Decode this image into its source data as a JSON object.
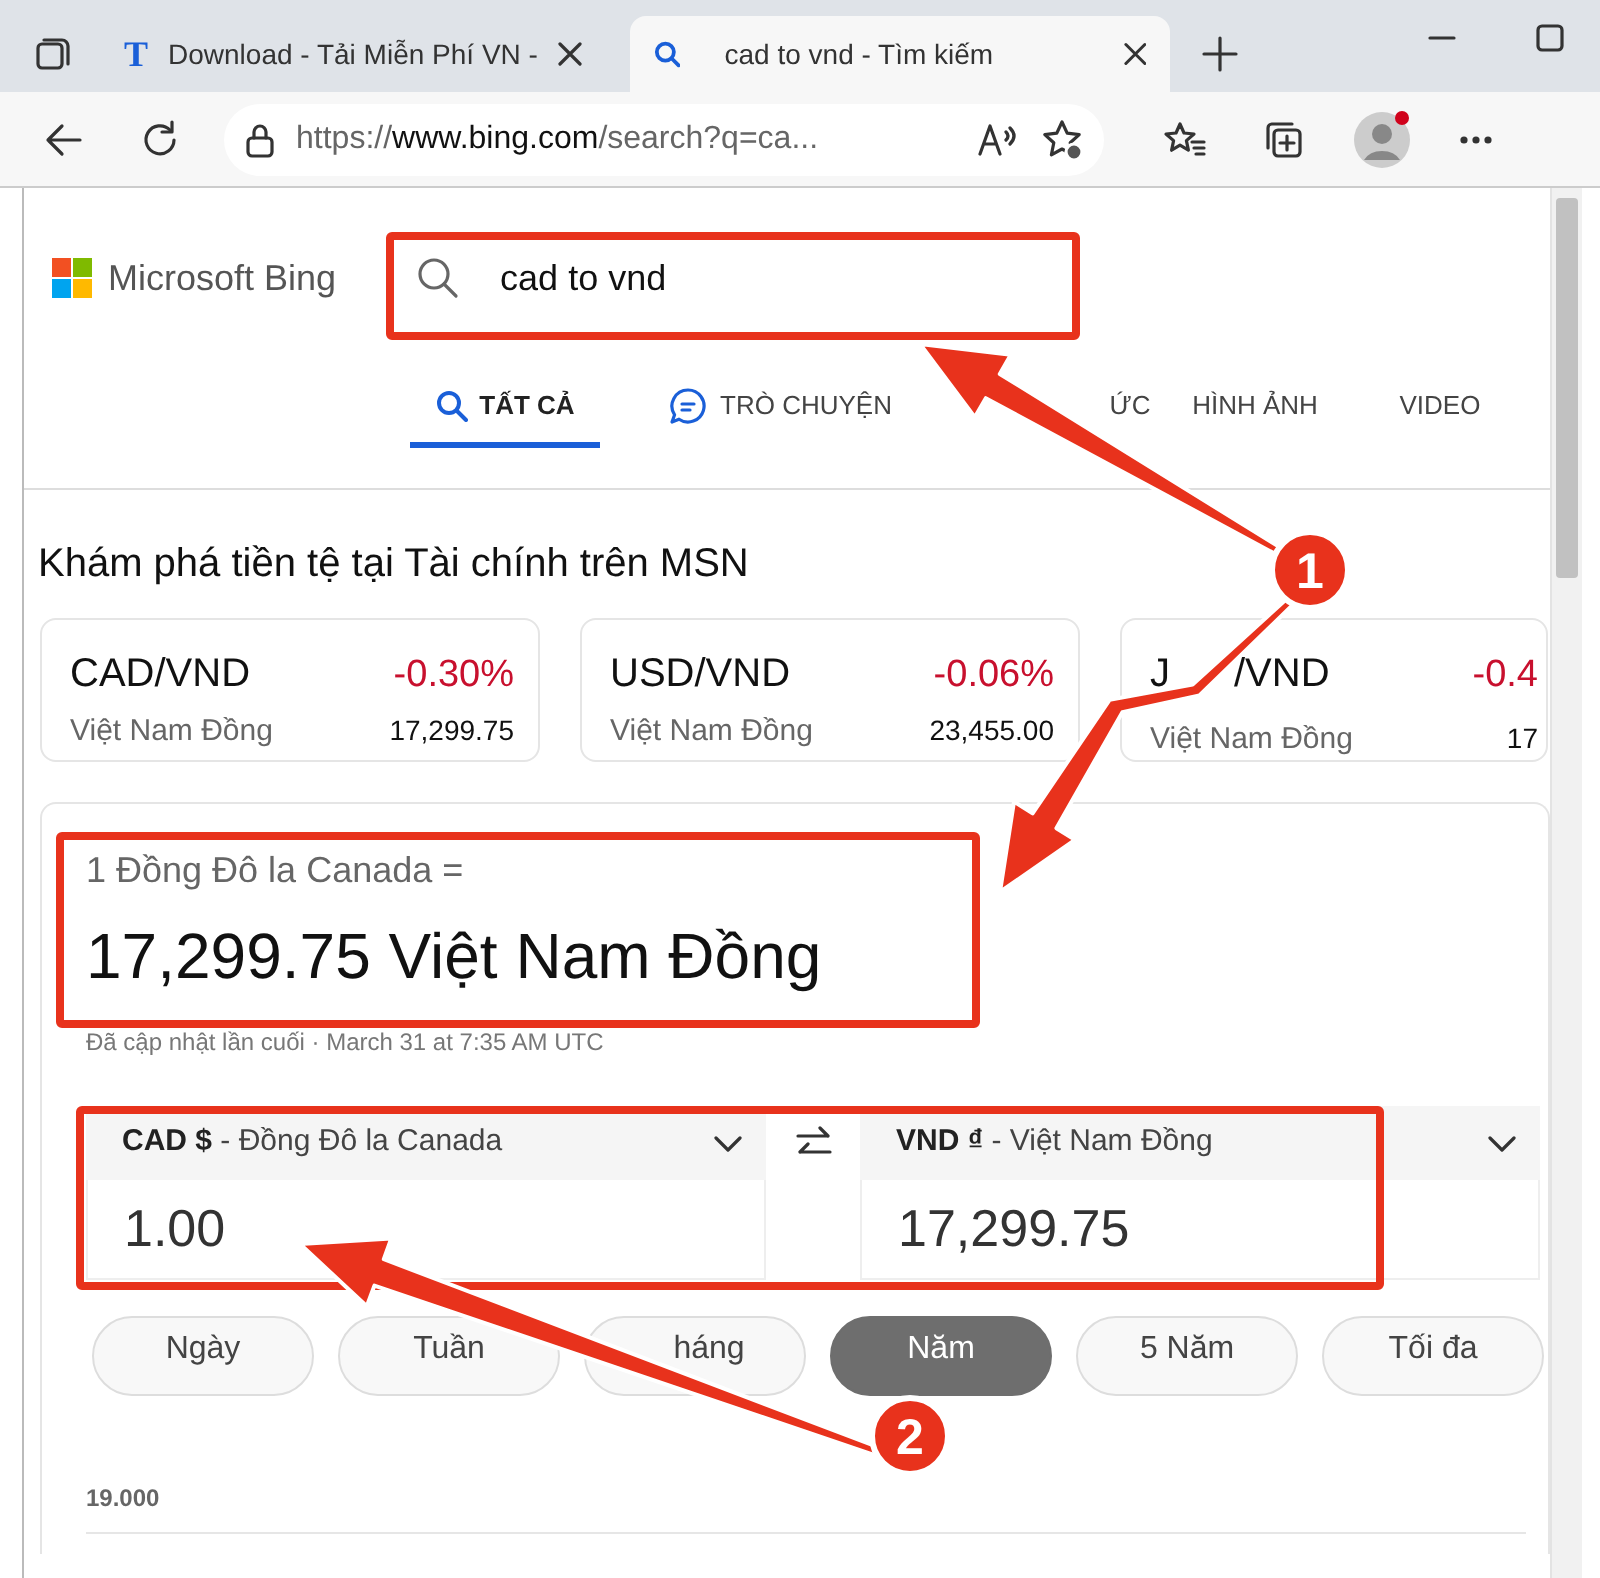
{
  "browser": {
    "tabs": [
      {
        "favicon": "T",
        "title": "Download - Tải Miễn Phí VN -",
        "selected": false
      },
      {
        "title": "cad to vnd - Tìm kiếm",
        "selected": true
      }
    ],
    "address": {
      "scheme": "https://",
      "host": "www.bing.com",
      "path": "/search?q=ca..."
    }
  },
  "bing": {
    "logo": "Microsoft Bing",
    "query": "cad to vnd",
    "tabs": [
      {
        "label": "TẤT CẢ",
        "kind": "search",
        "selected": true
      },
      {
        "label": "TRÒ CHUYỆN",
        "kind": "chat",
        "selected": false
      },
      {
        "label": "ỨC",
        "kind": "plain",
        "selected": false
      },
      {
        "label": "HÌNH ẢNH",
        "kind": "plain",
        "selected": false
      },
      {
        "label": "VIDEO",
        "kind": "plain",
        "selected": false
      }
    ]
  },
  "explore": {
    "title": "Khám phá tiền tệ tại Tài chính trên MSN",
    "cards": [
      {
        "pair": "CAD/VND",
        "change": "-0.30%",
        "name": "Việt Nam Đồng",
        "rate": "17,299.75"
      },
      {
        "pair": "USD/VND",
        "change": "-0.06%",
        "name": "Việt Nam Đồng",
        "rate": "23,455.00"
      },
      {
        "pair": "J",
        "pair_tail": "/VND",
        "change": "-0.4",
        "name": "Việt Nam Đồng",
        "rate": "17"
      }
    ]
  },
  "converter": {
    "label": "1 Đồng Đô la Canada =",
    "result": "17,299.75 Việt Nam Đồng",
    "updated": "Đã cập nhật lần cuối · March 31 at 7:35 AM UTC",
    "from": {
      "currency": "**CAD $** - Đồng Đô la Canada",
      "value": "1.00"
    },
    "to": {
      "currency": "**VND ₫** - Việt Nam Đồng",
      "value": "17,299.75"
    },
    "periods": [
      {
        "label": "Ngày",
        "selected": false
      },
      {
        "label": "Tuần",
        "selected": false
      },
      {
        "label": "háng",
        "selected": false
      },
      {
        "label": "Năm",
        "selected": true
      },
      {
        "label": "5 Năm",
        "selected": false
      },
      {
        "label": "Tối đa",
        "selected": false
      }
    ],
    "chart_tick": "19.000"
  },
  "annotations": [
    {
      "kind": "badge",
      "label": "1"
    },
    {
      "kind": "badge",
      "label": "2"
    }
  ]
}
